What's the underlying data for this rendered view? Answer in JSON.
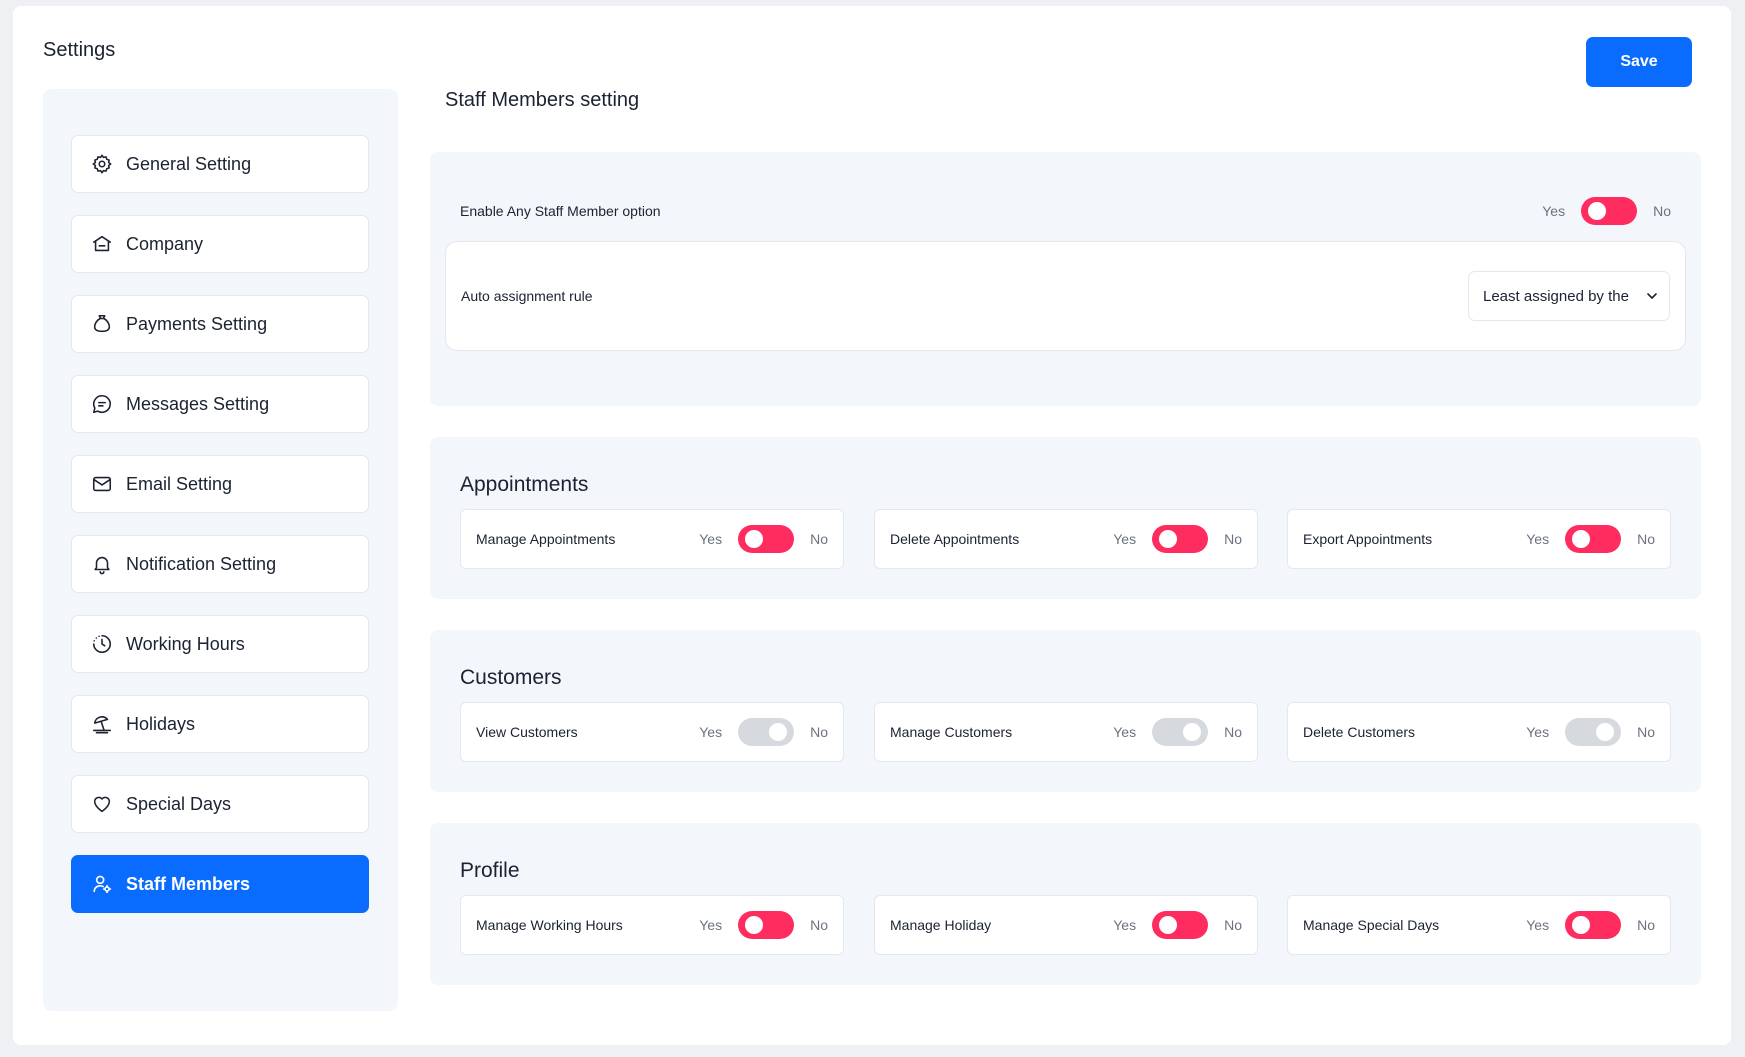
{
  "page": {
    "title": "Settings",
    "save_label": "Save"
  },
  "colors": {
    "accent": "#0a6cff",
    "toggle_on": "#ff2d5f",
    "toggle_off": "#d6d9de"
  },
  "sidebar": {
    "items": [
      {
        "label": "General Setting",
        "icon": "gear-icon"
      },
      {
        "label": "Company",
        "icon": "building-icon"
      },
      {
        "label": "Payments Setting",
        "icon": "money-bag-icon"
      },
      {
        "label": "Messages Setting",
        "icon": "chat-icon"
      },
      {
        "label": "Email Setting",
        "icon": "mail-icon"
      },
      {
        "label": "Notification Setting",
        "icon": "bell-icon"
      },
      {
        "label": "Working Hours",
        "icon": "clock-icon"
      },
      {
        "label": "Holidays",
        "icon": "beach-icon"
      },
      {
        "label": "Special Days",
        "icon": "heart-icon"
      },
      {
        "label": "Staff Members",
        "icon": "user-gear-icon",
        "active": true
      }
    ]
  },
  "main": {
    "title": "Staff Members setting",
    "general": {
      "enable_label": "Enable Any Staff Member option",
      "yes": "Yes",
      "no": "No",
      "enable_on": true,
      "assign_label": "Auto assignment rule",
      "assign_value": "Least assigned by the"
    },
    "appointments": {
      "heading": "Appointments",
      "items": [
        {
          "label": "Manage Appointments",
          "yes": "Yes",
          "no": "No",
          "on": true
        },
        {
          "label": "Delete Appointments",
          "yes": "Yes",
          "no": "No",
          "on": true
        },
        {
          "label": "Export Appointments",
          "yes": "Yes",
          "no": "No",
          "on": true
        }
      ]
    },
    "customers": {
      "heading": "Customers",
      "items": [
        {
          "label": "View Customers",
          "yes": "Yes",
          "no": "No",
          "on": false
        },
        {
          "label": "Manage Customers",
          "yes": "Yes",
          "no": "No",
          "on": false
        },
        {
          "label": "Delete Customers",
          "yes": "Yes",
          "no": "No",
          "on": false
        }
      ]
    },
    "profile": {
      "heading": "Profile",
      "items": [
        {
          "label": "Manage Working Hours",
          "yes": "Yes",
          "no": "No",
          "on": true
        },
        {
          "label": "Manage Holiday",
          "yes": "Yes",
          "no": "No",
          "on": true
        },
        {
          "label": "Manage Special Days",
          "yes": "Yes",
          "no": "No",
          "on": true
        }
      ]
    }
  }
}
